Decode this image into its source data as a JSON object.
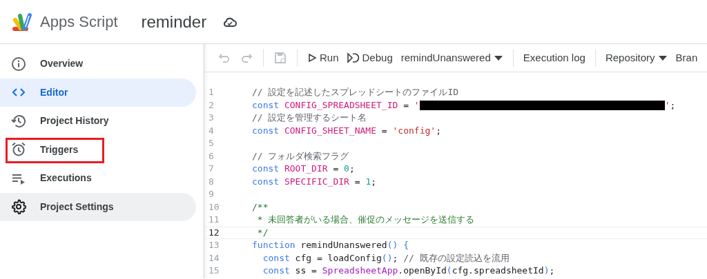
{
  "header": {
    "product": "Apps Script",
    "project": "reminder"
  },
  "sidebar": {
    "items": [
      {
        "label": "Overview",
        "selected": false,
        "hovered": false,
        "annotated": false
      },
      {
        "label": "Editor",
        "selected": true,
        "hovered": false,
        "annotated": false
      },
      {
        "label": "Project History",
        "selected": false,
        "hovered": false,
        "annotated": false
      },
      {
        "label": "Triggers",
        "selected": false,
        "hovered": false,
        "annotated": true
      },
      {
        "label": "Executions",
        "selected": false,
        "hovered": false,
        "annotated": false
      },
      {
        "label": "Project Settings",
        "selected": false,
        "hovered": true,
        "annotated": false
      }
    ]
  },
  "toolbar": {
    "undo": {
      "disabled": true
    },
    "redo": {
      "disabled": true
    },
    "save": {
      "disabled": true
    },
    "run": "Run",
    "debug": "Debug",
    "function_select": "remindUnanswered",
    "execution_log": "Execution log",
    "repository": "Repository",
    "cut_off_item": "Bran"
  },
  "editor": {
    "lines": [
      {
        "number": "1",
        "current": false,
        "tokens": [
          {
            "kind": "comment",
            "text": "// 設定を記述したスプレッドシートのファイルID"
          }
        ]
      },
      {
        "number": "2",
        "current": false,
        "tokens": [
          {
            "kind": "keyword",
            "text": "const"
          },
          {
            "kind": "variable",
            "text": " CONFIG_SPREADSHEET_ID"
          },
          {
            "kind": "plain",
            "text": " = "
          },
          {
            "kind": "string",
            "text": "'"
          },
          {
            "kind": "redacted"
          },
          {
            "kind": "string",
            "text": "'"
          },
          {
            "kind": "plain",
            "text": ";"
          }
        ]
      },
      {
        "number": "3",
        "current": false,
        "tokens": [
          {
            "kind": "comment",
            "text": "// 設定を管理するシート名"
          }
        ]
      },
      {
        "number": "4",
        "current": false,
        "tokens": [
          {
            "kind": "keyword",
            "text": "const"
          },
          {
            "kind": "variable",
            "text": " CONFIG_SHEET_NAME"
          },
          {
            "kind": "plain",
            "text": " = "
          },
          {
            "kind": "string",
            "text": "'config'"
          },
          {
            "kind": "plain",
            "text": ";"
          }
        ]
      },
      {
        "number": "5",
        "current": false
      },
      {
        "number": "6",
        "current": false,
        "tokens": [
          {
            "kind": "comment",
            "text": "// フォルダ検索フラグ"
          }
        ]
      },
      {
        "number": "7",
        "current": false,
        "tokens": [
          {
            "kind": "keyword",
            "text": "const"
          },
          {
            "kind": "variable",
            "text": " ROOT_DIR"
          },
          {
            "kind": "plain",
            "text": " = "
          },
          {
            "kind": "number",
            "text": "0"
          },
          {
            "kind": "plain",
            "text": ";"
          }
        ]
      },
      {
        "number": "8",
        "current": false,
        "tokens": [
          {
            "kind": "keyword",
            "text": "const"
          },
          {
            "kind": "variable",
            "text": " SPECIFIC_DIR"
          },
          {
            "kind": "plain",
            "text": " = "
          },
          {
            "kind": "number",
            "text": "1"
          },
          {
            "kind": "plain",
            "text": ";"
          }
        ]
      },
      {
        "number": "9",
        "current": false
      },
      {
        "number": "10",
        "current": false,
        "tokens": [
          {
            "kind": "doc",
            "text": "/**"
          }
        ]
      },
      {
        "number": "11",
        "current": false,
        "tokens": [
          {
            "kind": "doc",
            "text": " * 未回答者がいる場合、催促のメッセージを送信する"
          }
        ]
      },
      {
        "number": "12",
        "current": true,
        "tokens": [
          {
            "kind": "doc",
            "text": " */"
          }
        ]
      },
      {
        "number": "13",
        "current": false,
        "tokens": [
          {
            "kind": "keyword",
            "text": "function"
          },
          {
            "kind": "plain",
            "text": " remindUnanswered"
          },
          {
            "kind": "keyword",
            "text": "()"
          },
          {
            "kind": "keyword",
            "text": " {"
          }
        ]
      },
      {
        "number": "14",
        "current": false,
        "tokens": [
          {
            "kind": "keyword",
            "text": "  const"
          },
          {
            "kind": "plain",
            "text": " cfg = loadConfig"
          },
          {
            "kind": "keyword",
            "text": "()"
          },
          {
            "kind": "plain",
            "text": "; "
          },
          {
            "kind": "comment",
            "text": "// 既存の設定読込を流用"
          }
        ]
      },
      {
        "number": "15",
        "current": false,
        "tokens": [
          {
            "kind": "keyword",
            "text": "  const"
          },
          {
            "kind": "plain",
            "text": " ss = "
          },
          {
            "kind": "class",
            "text": "SpreadsheetApp"
          },
          {
            "kind": "plain",
            "text": ".openById"
          },
          {
            "kind": "keyword",
            "text": "("
          },
          {
            "kind": "plain",
            "text": "cfg.spreadsheetId"
          },
          {
            "kind": "keyword",
            "text": ")"
          },
          {
            "kind": "plain",
            "text": ";"
          }
        ]
      }
    ]
  }
}
